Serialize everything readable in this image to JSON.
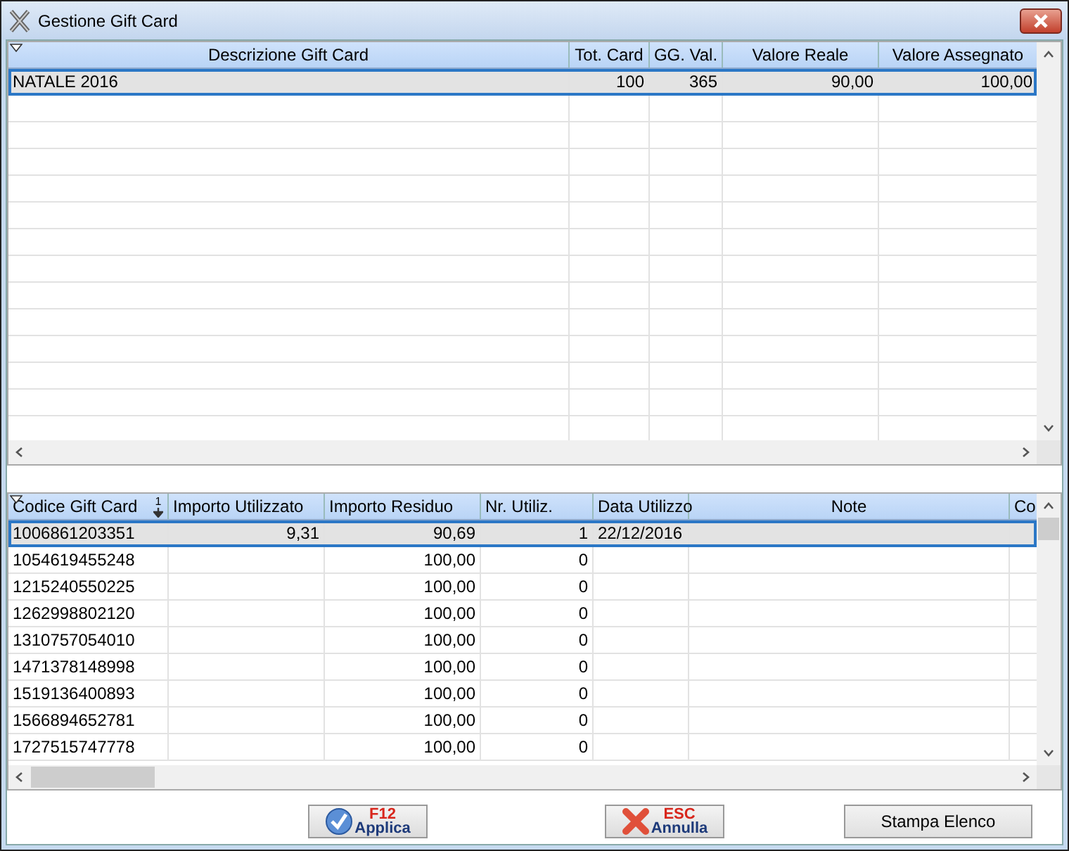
{
  "window": {
    "title": "Gestione Gift Card"
  },
  "gift_cards_table": {
    "columns": [
      "Descrizione Gift Card",
      "Tot. Card",
      "GG. Val.",
      "Valore Reale",
      "Valore Assegnato"
    ],
    "rows": [
      {
        "cells": [
          "NATALE 2016",
          "100",
          "365",
          "90,00",
          "100,00"
        ],
        "selected": true
      }
    ]
  },
  "codes_table": {
    "columns": [
      "Codice Gift Card",
      "Importo Utilizzato",
      "Importo Residuo",
      "Nr. Utiliz.",
      "Data Utilizzo",
      "Note",
      "Co"
    ],
    "sort_order": "1",
    "rows": [
      {
        "cells": [
          "1006861203351",
          "9,31",
          "90,69",
          "1",
          "22/12/2016",
          "",
          ""
        ],
        "selected": true
      },
      {
        "cells": [
          "1054619455248",
          "",
          "100,00",
          "0",
          "",
          "",
          ""
        ],
        "selected": false
      },
      {
        "cells": [
          "1215240550225",
          "",
          "100,00",
          "0",
          "",
          "",
          ""
        ],
        "selected": false
      },
      {
        "cells": [
          "1262998802120",
          "",
          "100,00",
          "0",
          "",
          "",
          ""
        ],
        "selected": false
      },
      {
        "cells": [
          "1310757054010",
          "",
          "100,00",
          "0",
          "",
          "",
          ""
        ],
        "selected": false
      },
      {
        "cells": [
          "1471378148998",
          "",
          "100,00",
          "0",
          "",
          "",
          ""
        ],
        "selected": false
      },
      {
        "cells": [
          "1519136400893",
          "",
          "100,00",
          "0",
          "",
          "",
          ""
        ],
        "selected": false
      },
      {
        "cells": [
          "1566894652781",
          "",
          "100,00",
          "0",
          "",
          "",
          ""
        ],
        "selected": false
      },
      {
        "cells": [
          "1727515747778",
          "",
          "100,00",
          "0",
          "",
          "",
          ""
        ],
        "selected": false
      }
    ]
  },
  "buttons": [
    {
      "kind": "apply",
      "key": "F12",
      "label": "Applica"
    },
    {
      "kind": "cancel",
      "key": "ESC",
      "label": "Annulla"
    },
    {
      "kind": "plain",
      "label": "Stampa Elenco"
    }
  ]
}
